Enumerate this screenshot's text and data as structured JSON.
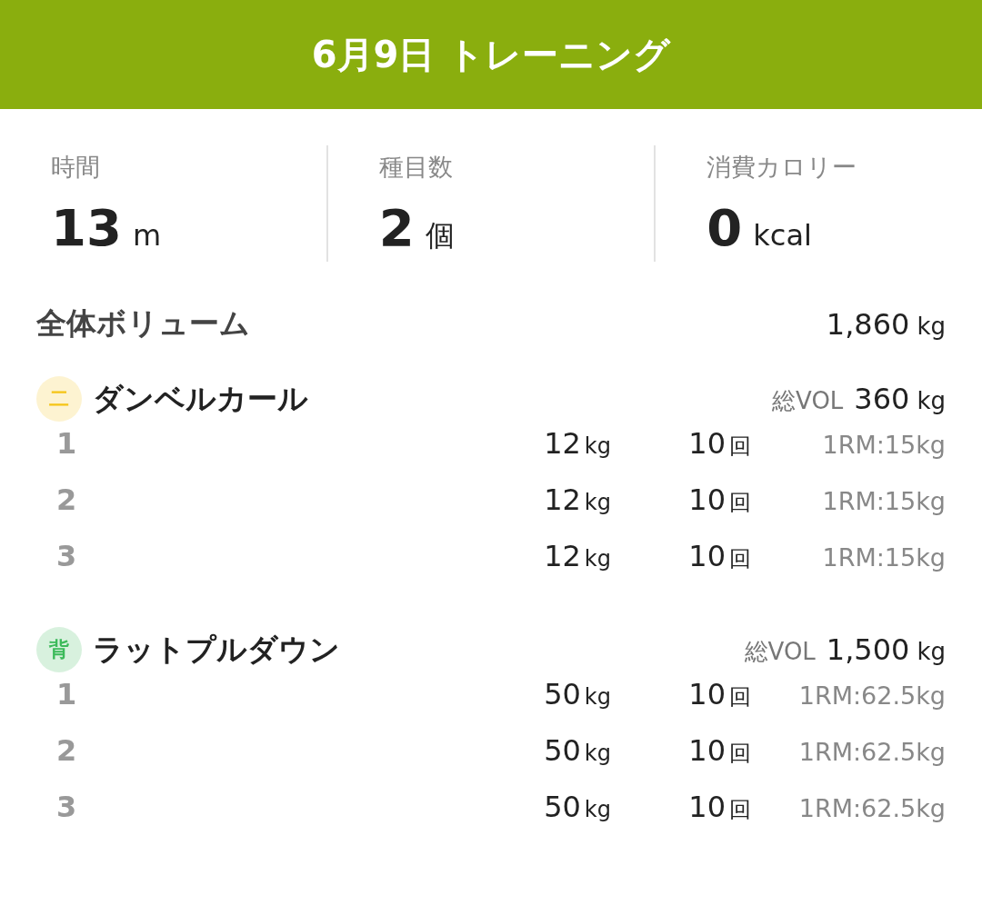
{
  "header": {
    "title": "6月9日  トレーニング"
  },
  "stats": [
    {
      "label": "時間",
      "value": "13",
      "unit": "m"
    },
    {
      "label": "種目数",
      "value": "2",
      "unit": "個"
    },
    {
      "label": "消費カロリー",
      "value": "0",
      "unit": "kcal"
    }
  ],
  "total_volume": {
    "label": "全体ボリューム",
    "value": "1,860",
    "unit": "kg"
  },
  "exercises": [
    {
      "badge": "二",
      "color": "#f5c518",
      "name": "ダンベルカール",
      "vol_label": "総VOL",
      "vol_value": "360",
      "vol_unit": "kg",
      "sets": [
        {
          "number": "1",
          "weight": "12",
          "weight_unit": "kg",
          "reps": "10",
          "reps_unit": "回",
          "one_rm": "1RM:15kg"
        },
        {
          "number": "2",
          "weight": "12",
          "weight_unit": "kg",
          "reps": "10",
          "reps_unit": "回",
          "one_rm": "1RM:15kg"
        },
        {
          "number": "3",
          "weight": "12",
          "weight_unit": "kg",
          "reps": "10",
          "reps_unit": "回",
          "one_rm": "1RM:15kg"
        }
      ]
    },
    {
      "badge": "背",
      "color": "#3cba5a",
      "name": "ラットプルダウン",
      "vol_label": "総VOL",
      "vol_value": "1,500",
      "vol_unit": "kg",
      "sets": [
        {
          "number": "1",
          "weight": "50",
          "weight_unit": "kg",
          "reps": "10",
          "reps_unit": "回",
          "one_rm": "1RM:62.5kg"
        },
        {
          "number": "2",
          "weight": "50",
          "weight_unit": "kg",
          "reps": "10",
          "reps_unit": "回",
          "one_rm": "1RM:62.5kg"
        },
        {
          "number": "3",
          "weight": "50",
          "weight_unit": "kg",
          "reps": "10",
          "reps_unit": "回",
          "one_rm": "1RM:62.5kg"
        }
      ]
    }
  ]
}
